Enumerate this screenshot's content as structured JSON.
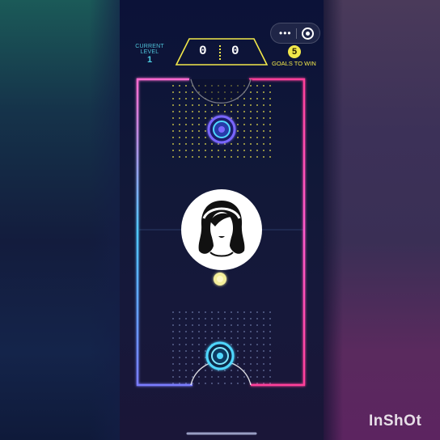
{
  "hud": {
    "level_label_line1": "CURRENT",
    "level_label_line2": "LEVEL",
    "level_value": "1",
    "score_player": "0",
    "score_opponent": "0",
    "goals_to_win_value": "5",
    "goals_to_win_label": "GOALS TO WIN"
  },
  "capsule": {
    "menu_glyph": "•••"
  },
  "center_avatar": {
    "icon": "woman-headband-silhouette-icon"
  },
  "watermark": {
    "text": "InShOt"
  },
  "colors": {
    "neon_cyan": "#3fd7ff",
    "neon_pink": "#ff3fa8",
    "neon_yellow": "#f2e84a",
    "field_line": "#2a3a66"
  }
}
